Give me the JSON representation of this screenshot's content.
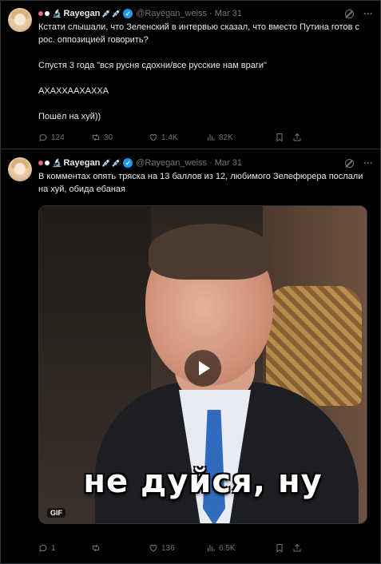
{
  "tweets": [
    {
      "author": "Rayegan",
      "emoji": "💉💉",
      "handle": "@Rayegan_weiss",
      "separator": "·",
      "date": "Mar 31",
      "paragraphs": [
        "Кстати слышали, что Зеленский в интервью сказал, что вместо Путина готов с рос. оппозицией говорить?",
        "Спустя 3 года \"вся русня сдохни/все русские нам враги\"",
        "АХАХХААХАХХА",
        "Пошёл на хуй))"
      ],
      "stats": {
        "replies": "124",
        "reposts": "30",
        "likes": "1.4K",
        "views": "82K"
      }
    },
    {
      "author": "Rayegan",
      "emoji": "💉💉",
      "handle": "@Rayegan_weiss",
      "separator": "·",
      "date": "Mar 31",
      "text": "В комментах опять тряска на 13 баллов из 12, любимого Зелефюрера послали на хуй, обида ебаная",
      "media": {
        "caption": "не дуйся, ну",
        "badge": "GIF"
      },
      "stats": {
        "replies": "1",
        "reposts": "",
        "likes": "136",
        "views": "6.5K"
      }
    }
  ],
  "icons": [
    "reply-icon",
    "repost-icon",
    "like-icon",
    "views-icon",
    "bookmark-icon",
    "share-icon",
    "grok-icon",
    "more-icon",
    "verified-icon",
    "play-icon"
  ],
  "colors": {
    "background": "#000000",
    "text": "#e7e9ea",
    "muted": "#71767b",
    "verified": "#1d9bf0",
    "divider": "#2f3336"
  }
}
